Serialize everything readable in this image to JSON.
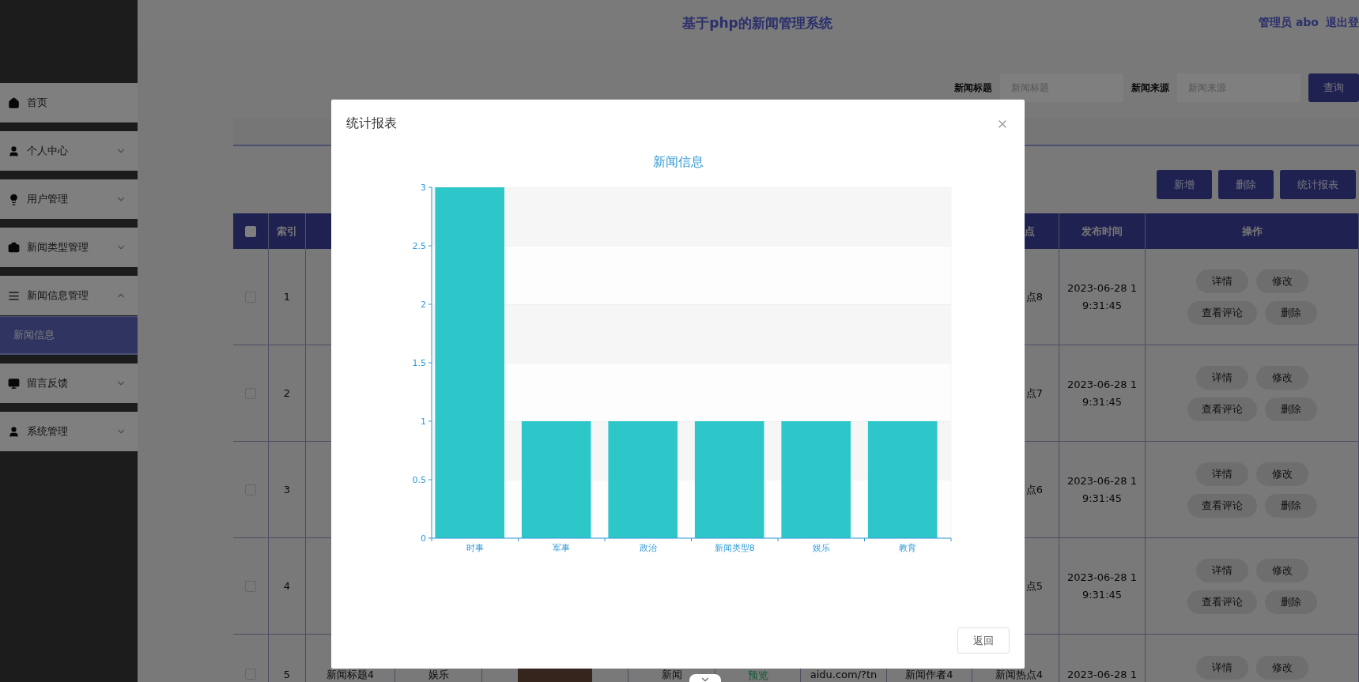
{
  "header": {
    "title": "基于php的新闻管理系统",
    "user": "管理员 abo",
    "logout": "退出登"
  },
  "sidebar": {
    "items": [
      {
        "label": "首页",
        "kind": "link"
      },
      {
        "label": "个人中心",
        "kind": "menu",
        "expanded": false
      },
      {
        "label": "用户管理",
        "kind": "menu",
        "expanded": false
      },
      {
        "label": "新闻类型管理",
        "kind": "menu",
        "expanded": false
      },
      {
        "label": "新闻信息管理",
        "kind": "menu",
        "expanded": true,
        "children": [
          {
            "label": "新闻信息",
            "selected": true
          }
        ]
      },
      {
        "label": "留言反馈",
        "kind": "menu",
        "expanded": false
      },
      {
        "label": "系统管理",
        "kind": "menu",
        "expanded": false
      }
    ]
  },
  "search": {
    "fields": [
      {
        "label": "新闻标题",
        "placeholder": "新闻标题"
      },
      {
        "label": "新闻来源",
        "placeholder": "新闻来源"
      }
    ],
    "button": "查询"
  },
  "actions": [
    "新增",
    "删除",
    "统计报表"
  ],
  "table": {
    "header": {
      "checkbox": {
        "checked": false
      },
      "index": "索引",
      "hotspot": "点",
      "time": "发布时间",
      "actions": "操作"
    },
    "rows": [
      {
        "checked": false,
        "index": "1",
        "hotspot": "点8",
        "time": "2023-06-28 19:31:45",
        "actions": [
          "详情",
          "修改",
          "查看评论",
          "删除"
        ]
      },
      {
        "checked": false,
        "index": "2",
        "hotspot": "点7",
        "time": "2023-06-28 19:31:45",
        "actions": [
          "详情",
          "修改",
          "查看评论",
          "删除"
        ]
      },
      {
        "checked": false,
        "index": "3",
        "hotspot": "点6",
        "time": "2023-06-28 19:31:45",
        "actions": [
          "详情",
          "修改",
          "查看评论",
          "删除"
        ]
      },
      {
        "checked": false,
        "index": "4",
        "hotspot": "点5",
        "time": "2023-06-28 19:31:45",
        "actions": [
          "详情",
          "修改",
          "查看评论",
          "删除"
        ]
      },
      {
        "checked": false,
        "index": "5",
        "title": "新闻标题4",
        "type": "娱乐",
        "photo": true,
        "source": "新闻",
        "preview": "预览",
        "url": "aidu.com/?tn",
        "author": "新闻作者4",
        "hotspot": "新闻热点4",
        "time": "2023-06-28 1",
        "actions": [
          "详情",
          "修改"
        ]
      }
    ]
  },
  "modal": {
    "title": "统计报表",
    "button": "返回",
    "chart_data": {
      "type": "bar",
      "title": "新闻信息",
      "categories": [
        "时事",
        "军事",
        "政治",
        "新闻类型8",
        "娱乐",
        "教育"
      ],
      "values": [
        3,
        1,
        1,
        1,
        1,
        1
      ],
      "ylim": [
        0,
        3
      ],
      "yticks": [
        0,
        0.5,
        1,
        1.5,
        2,
        2.5,
        3
      ]
    }
  }
}
